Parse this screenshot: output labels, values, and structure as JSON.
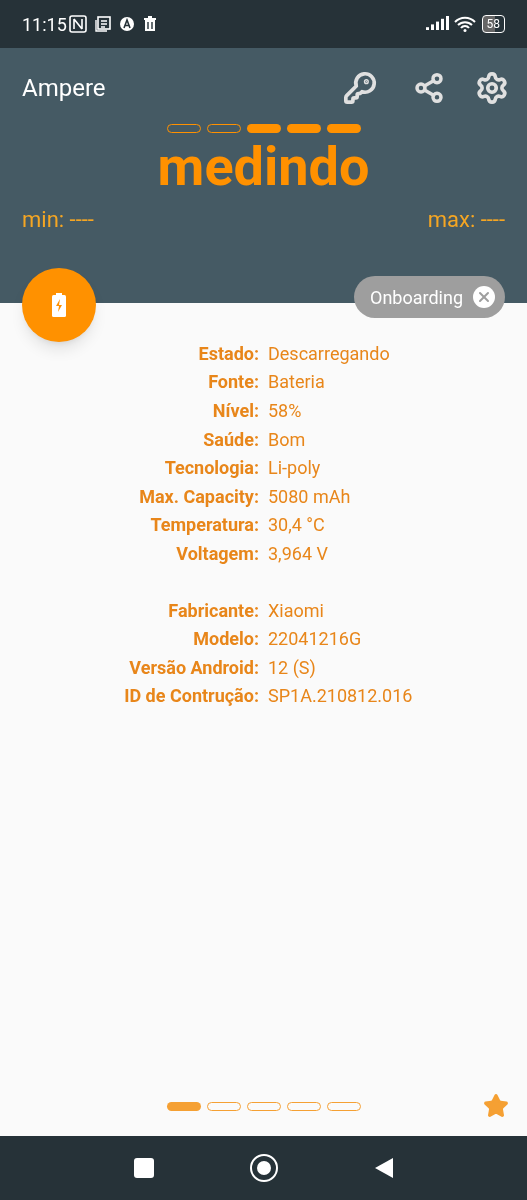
{
  "status_bar": {
    "time": "11:15",
    "battery": "58"
  },
  "app_bar": {
    "title": "Ampere"
  },
  "meter_segments": [
    {
      "filled": false
    },
    {
      "filled": false
    },
    {
      "filled": true
    },
    {
      "filled": true
    },
    {
      "filled": true
    }
  ],
  "reading": "medindo",
  "min": "min: ----",
  "max": "max: ----",
  "onboarding_chip": {
    "label": "Onboarding"
  },
  "info_groups": [
    [
      {
        "label": "Estado:",
        "value": "Descarregando"
      },
      {
        "label": "Fonte:",
        "value": "Bateria"
      },
      {
        "label": "Nível:",
        "value": "58%"
      },
      {
        "label": "Saúde:",
        "value": "Bom"
      },
      {
        "label": "Tecnologia:",
        "value": "Li-poly"
      },
      {
        "label": "Max. Capacity:",
        "value": "5080 mAh"
      },
      {
        "label": "Temperatura:",
        "value": "30,4 °C"
      },
      {
        "label": "Voltagem:",
        "value": "3,964 V"
      }
    ],
    [
      {
        "label": "Fabricante:",
        "value": "Xiaomi"
      },
      {
        "label": "Modelo:",
        "value": "22041216G"
      },
      {
        "label": "Versão Android:",
        "value": "12 (S)"
      },
      {
        "label": "ID de Contrução:",
        "value": "SP1A.210812.016"
      }
    ]
  ],
  "pages": [
    {
      "selected": true
    },
    {
      "selected": false
    },
    {
      "selected": false
    },
    {
      "selected": false
    },
    {
      "selected": false
    }
  ]
}
